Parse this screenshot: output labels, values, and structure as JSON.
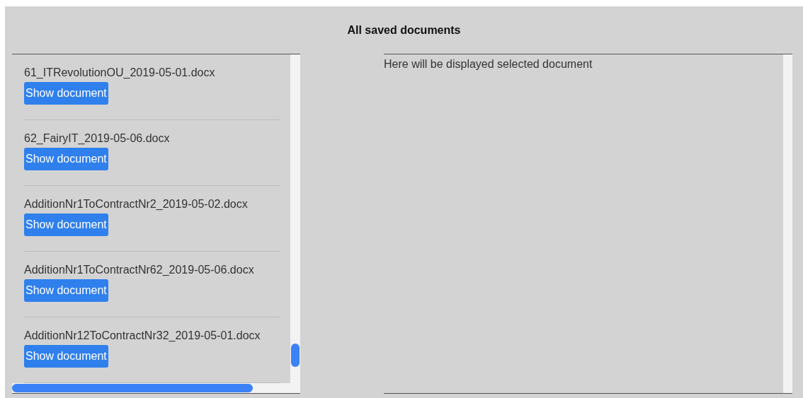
{
  "title": "All saved documents",
  "documents": [
    {
      "filename": "61_ITRevolutionOU_2019-05-01.docx",
      "button": "Show document"
    },
    {
      "filename": "62_FairyIT_2019-05-06.docx",
      "button": "Show document"
    },
    {
      "filename": "AdditionNr1ToContractNr2_2019-05-02.docx",
      "button": "Show document"
    },
    {
      "filename": "AdditionNr1ToContractNr62_2019-05-06.docx",
      "button": "Show document"
    },
    {
      "filename": "AdditionNr12ToContractNr32_2019-05-01.docx",
      "button": "Show document"
    }
  ],
  "viewer": {
    "placeholder_text": "Here will be displayed selected document"
  }
}
